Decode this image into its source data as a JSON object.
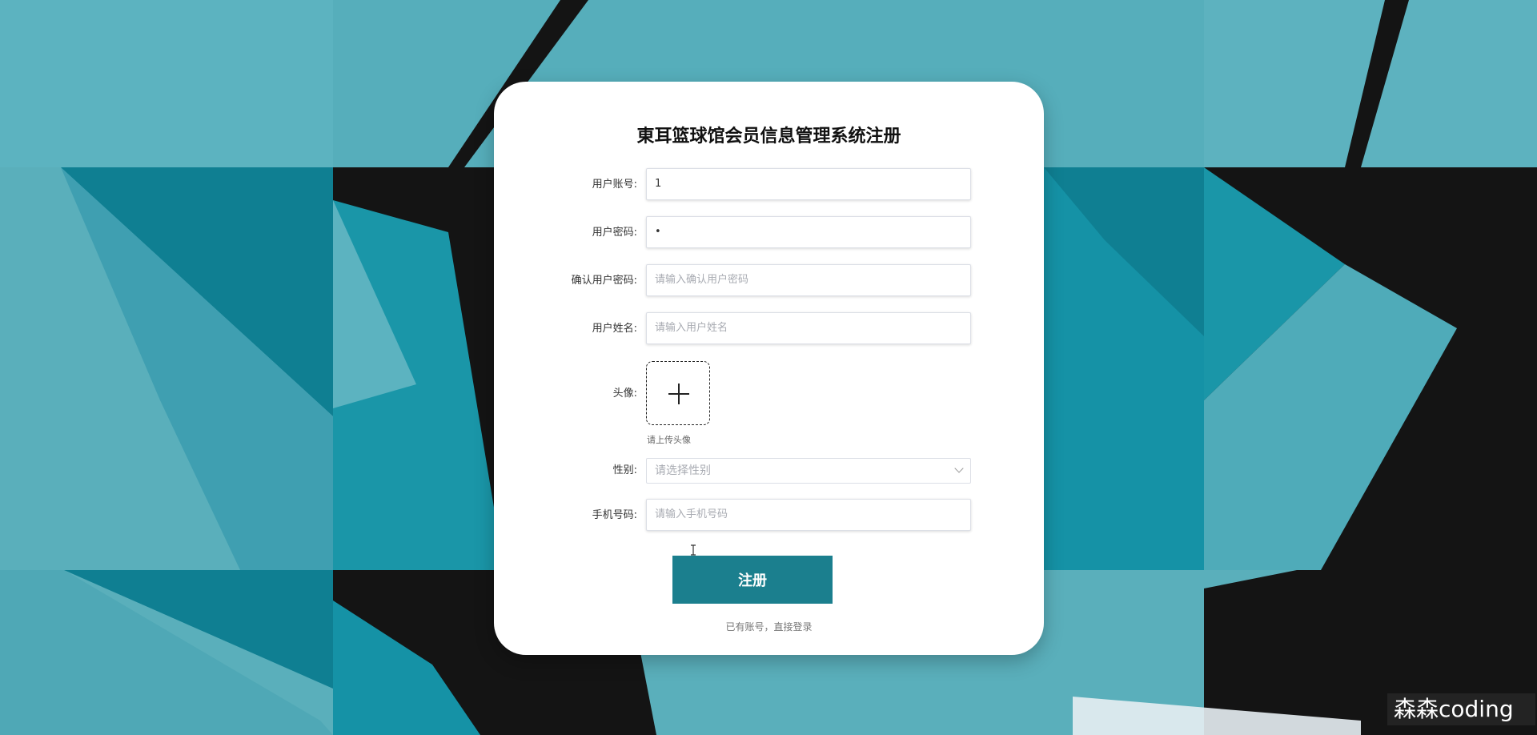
{
  "form": {
    "title": "東耳篮球馆会员信息管理系统注册",
    "username": {
      "label": "用户账号:",
      "value": "1"
    },
    "password": {
      "label": "用户密码:",
      "value": "•"
    },
    "confirm_password": {
      "label": "确认用户密码:",
      "placeholder": "请输入确认用户密码"
    },
    "real_name": {
      "label": "用户姓名:",
      "placeholder": "请输入用户姓名"
    },
    "avatar": {
      "label": "头像:",
      "tip": "请上传头像"
    },
    "gender": {
      "label": "性别:",
      "placeholder": "请选择性别"
    },
    "phone": {
      "label": "手机号码:",
      "placeholder": "请输入手机号码"
    },
    "submit_label": "注册",
    "login_link": "已有账号，直接登录"
  },
  "watermark": "森森coding",
  "colors": {
    "background_teal": "#5aafbb",
    "dark_band": "#141414",
    "deep_teal": "#0f7f92",
    "button": "#1b7f8e"
  }
}
